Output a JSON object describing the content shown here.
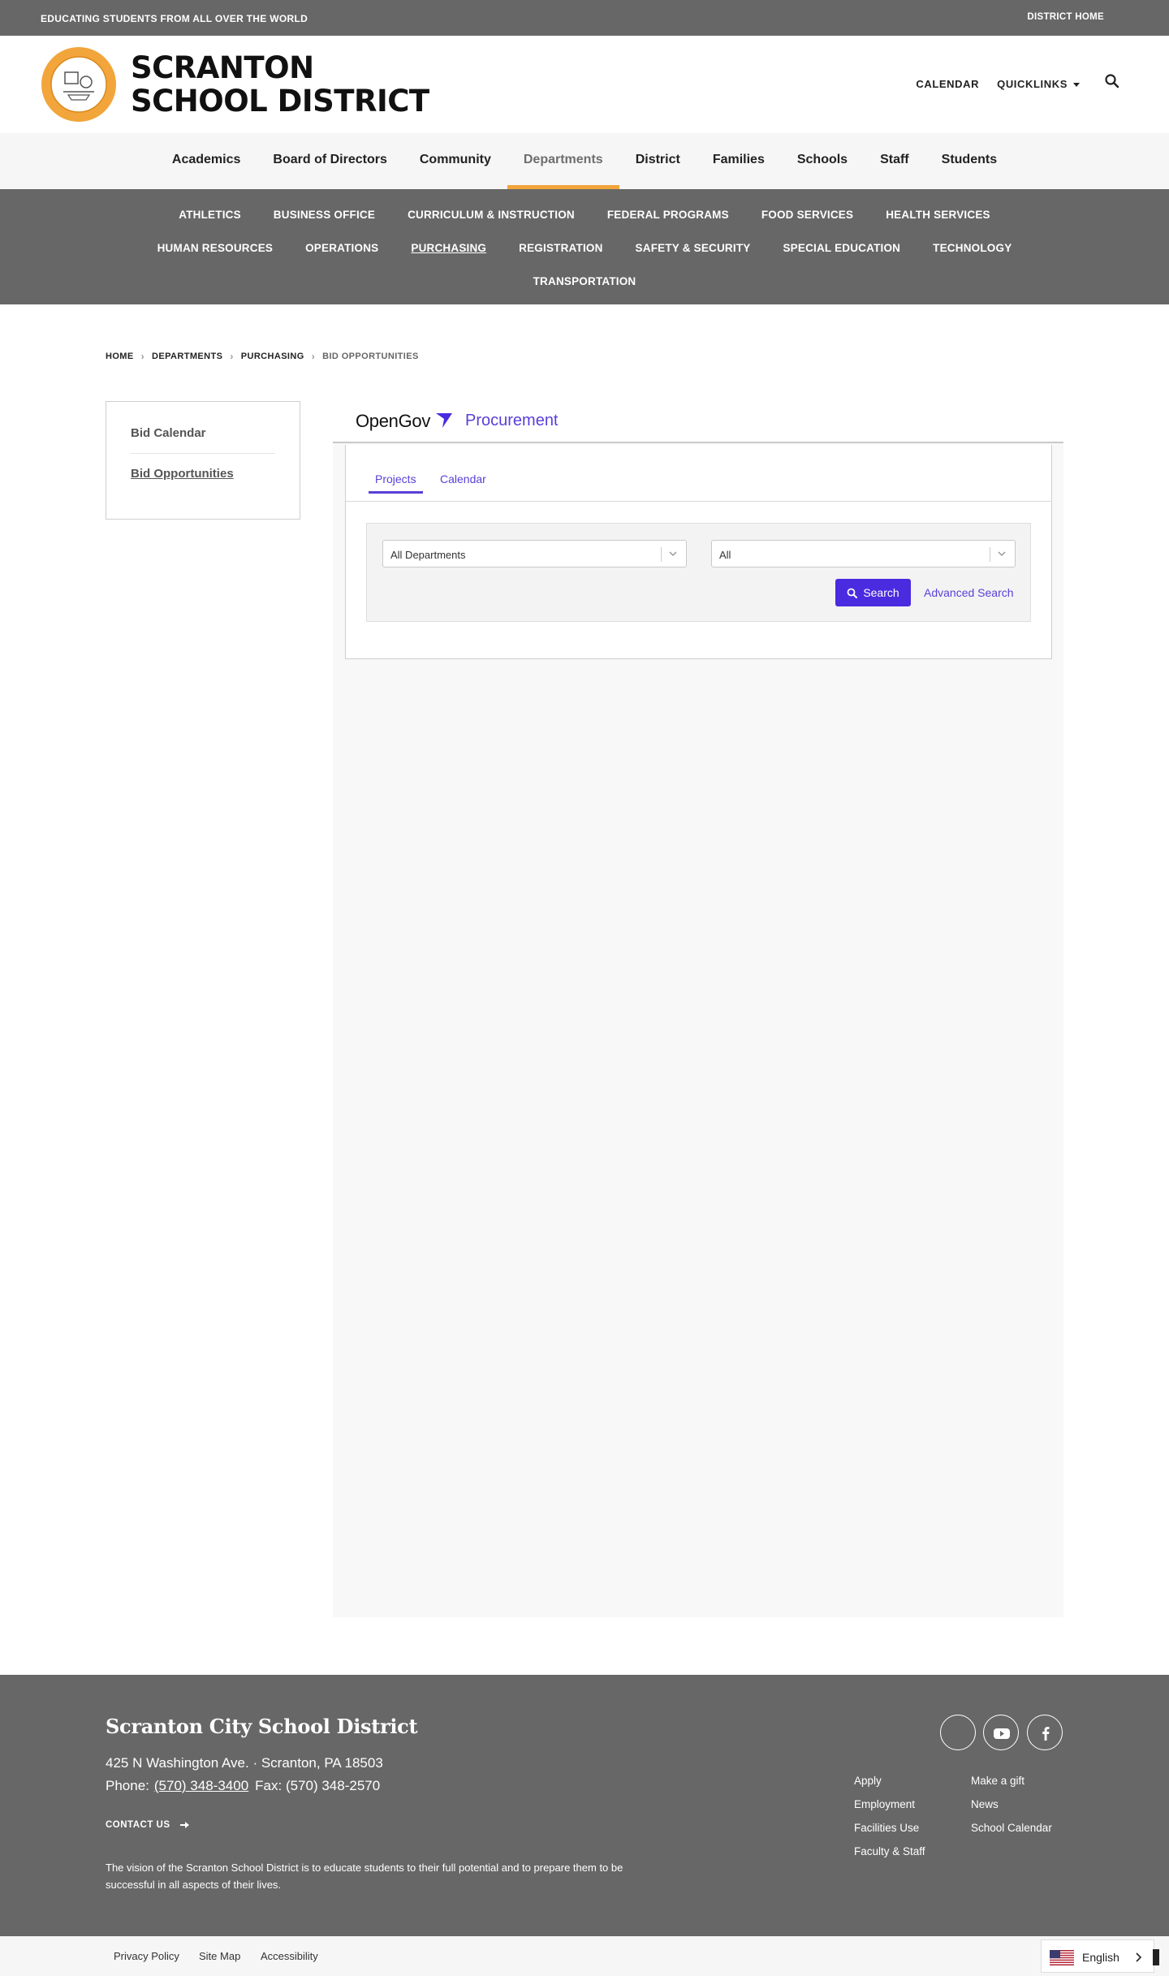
{
  "topbar": {
    "tagline": "EDUCATING STUDENTS FROM ALL OVER THE WORLD",
    "district_home": "DISTRICT HOME"
  },
  "header": {
    "name_line1": "SCRANTON",
    "name_line2": "SCHOOL DISTRICT",
    "calendar": "CALENDAR",
    "quicklinks": "QUICKLINKS",
    "accent_color": "#f2a53a"
  },
  "main_nav": [
    "Academics",
    "Board of Directors",
    "Community",
    "Departments",
    "District",
    "Families",
    "Schools",
    "Staff",
    "Students"
  ],
  "main_nav_active": "Departments",
  "sub_nav": {
    "row1": [
      "ATHLETICS",
      "BUSINESS OFFICE",
      "CURRICULUM & INSTRUCTION",
      "FEDERAL PROGRAMS",
      "FOOD SERVICES",
      "HEALTH SERVICES"
    ],
    "row2": [
      "HUMAN RESOURCES",
      "OPERATIONS",
      "PURCHASING",
      "REGISTRATION",
      "SAFETY & SECURITY",
      "SPECIAL EDUCATION",
      "TECHNOLOGY"
    ],
    "row3": [
      "TRANSPORTATION"
    ],
    "current": "PURCHASING"
  },
  "breadcrumb": [
    "HOME",
    "DEPARTMENTS",
    "PURCHASING",
    "BID OPPORTUNITIES"
  ],
  "side_nav": [
    "Bid Calendar",
    "Bid Opportunities"
  ],
  "opengov": {
    "brand": "OpenGov",
    "product": "Procurement",
    "tabs": [
      "Projects",
      "Calendar"
    ],
    "department_select": "All Departments",
    "status_select": "All",
    "search_button": "Search",
    "advanced_search": "Advanced Search",
    "accent_color": "#5a3fd8"
  },
  "footer": {
    "title": "Scranton City School District",
    "address": "425 N Washington Ave.  · Scranton, PA  18503",
    "phone_label": "Phone:",
    "phone": "(570) 348-3400",
    "fax": "Fax: (570) 348-2570",
    "contact_us": "CONTACT US",
    "vision": "The vision of the Scranton School District is to educate students to their full potential and to prepare them to be successful in all aspects of their lives.",
    "links_col1": [
      "Apply",
      "Employment",
      "Facilities Use",
      "Faculty & Staff"
    ],
    "links_col2": [
      "Make a gift",
      "News",
      "School Calendar"
    ],
    "social": [
      "instagram-icon",
      "youtube-icon",
      "facebook-icon"
    ]
  },
  "bottom_bar": {
    "links": [
      "Privacy Policy",
      "Site Map",
      "Accessibility"
    ],
    "language": "English"
  }
}
